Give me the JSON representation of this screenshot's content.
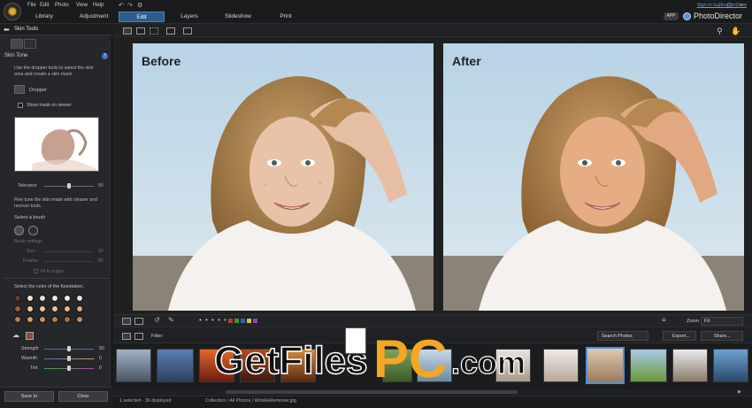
{
  "menu": [
    "File",
    "Edit",
    "Photo",
    "View",
    "Help"
  ],
  "modes": [
    "Library",
    "Adjustment",
    "Edit",
    "Layers",
    "Slideshow",
    "Print"
  ],
  "signin": "Sign in to DirectorZone",
  "app_badge": "APP",
  "brand": "PhotoDirector",
  "left_panel": {
    "title": "Skin Tools",
    "section": "Skin Tone",
    "info": "?",
    "desc1": "Use the dropper tools to select the skin area and create a skin mask.",
    "dropper": "Dropper",
    "show_mask": "Show mask on viewer",
    "tolerance_label": "Tolerance",
    "tolerance_value": "50",
    "tolerance_level": 0.5,
    "desc2": "Fine tune the skin mask with cleaner and recover tools.",
    "brush_label": "Select a brush",
    "brush_settings": "Brush settings",
    "size_label": "Size",
    "size_value": "20",
    "feather_label": "Feather",
    "feather_value": "80",
    "fit_edges": "Fit to edges",
    "foundation_label": "Select the color of the foundation.",
    "swatches": [
      [
        "#6b3a2e",
        "#f2e4d6",
        "#efe0cf",
        "#f4e9dc",
        "#f5ece2",
        "#f1e2d1"
      ],
      [
        "#9a5a3f",
        "#f0c9a6",
        "#efc7a0",
        "#eebf96",
        "#e8b48a",
        "#e2a67a"
      ],
      [
        "#b87a58",
        "#d99e6e",
        "#c98d5e",
        "#b87b4d",
        "#a86e43",
        "#c88768"
      ]
    ],
    "strength_label": "Strength",
    "strength_value": "50",
    "strength_level": 0.5,
    "warmth_label": "Warmth",
    "warmth_value": "0",
    "warmth_level": 0.5,
    "tint_label": "Tint",
    "tint_value": "0",
    "tint_level": 0.5,
    "save_label": "Save to",
    "clear_label": "Clear"
  },
  "viewer": {
    "before_label": "Before",
    "after_label": "After"
  },
  "filmstrip": {
    "filter_label": "Filter:",
    "zoom_label": "Zoom",
    "zoom_value": "Fit",
    "search_label": "Search Photos",
    "export_label": "Export...",
    "share_label": "Share...",
    "color_tags": [
      "#c0392b",
      "#2e9b3a",
      "#2a64c8",
      "#d4c12a",
      "#8e44ad"
    ]
  },
  "status": {
    "selected": "1 selected - 36 displayed",
    "path": "Collection / All Photos / WrinkleRemover.jpg"
  },
  "watermark": {
    "left_text": "GetFiles",
    "pc_text": "PC",
    "dotcom_text": ".com"
  }
}
